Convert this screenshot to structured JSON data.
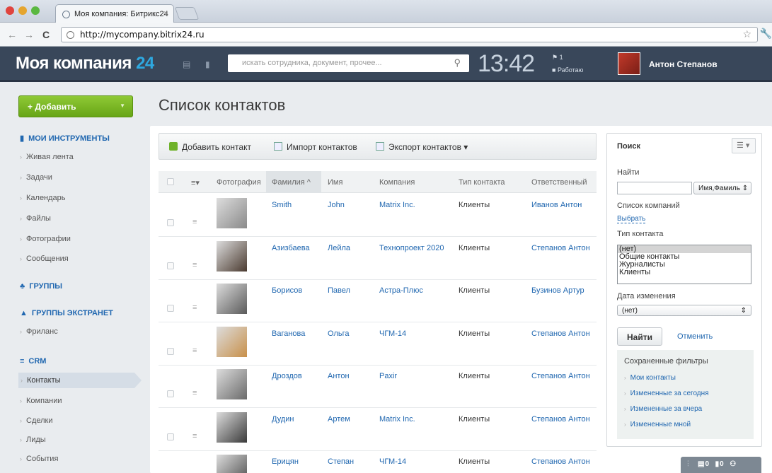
{
  "browser": {
    "tab_title": "Моя компания: Битрикс24",
    "tab_close": "×",
    "url": "http://mycompany.bitrix24.ru"
  },
  "header": {
    "logo_text": "Моя компания",
    "logo_number": "24",
    "search_placeholder": "искать сотрудника, документ, прочее...",
    "time": "13:42",
    "tasks_count": "1",
    "work_status": "Работаю",
    "user_name": "Антон Степанов"
  },
  "sidebar": {
    "add_button": "+ Добавить",
    "sections": {
      "tools": "МОИ ИНСТРУМЕНТЫ",
      "groups": "ГРУППЫ",
      "extranet": "ГРУППЫ ЭКСТРАНЕТ",
      "crm": "CRM"
    },
    "tools_items": [
      "Живая лента",
      "Задачи",
      "Календарь",
      "Файлы",
      "Фотографии",
      "Сообщения"
    ],
    "extranet_items": [
      "Фриланс"
    ],
    "crm_items": [
      "Контакты",
      "Компании",
      "Сделки",
      "Лиды",
      "События"
    ]
  },
  "page": {
    "title": "Список контактов"
  },
  "toolbar": {
    "add_contact": "Добавить контакт",
    "import": "Импорт контактов",
    "export": "Экспорт контактов"
  },
  "table": {
    "columns": {
      "photo": "Фотография",
      "last_name": "Фамилия",
      "first_name": "Имя",
      "company": "Компания",
      "type": "Тип контакта",
      "responsible": "Ответственный"
    },
    "sort_arrow": "^",
    "rows": [
      {
        "last_name": "Smith",
        "first_name": "John",
        "company": "Matrix Inc.",
        "type": "Клиенты",
        "responsible": "Иванов Антон",
        "photo_color": "#8a8a8a"
      },
      {
        "last_name": "Азизбаева",
        "first_name": "Лейла",
        "company": "Технопроект 2020",
        "type": "Клиенты",
        "responsible": "Степанов Антон",
        "photo_color": "#4a3a30"
      },
      {
        "last_name": "Борисов",
        "first_name": "Павел",
        "company": "Астра-Плюс",
        "type": "Клиенты",
        "responsible": "Бузинов Артур",
        "photo_color": "#5a5a5a"
      },
      {
        "last_name": "Ваганова",
        "first_name": "Ольга",
        "company": "ЧГМ-14",
        "type": "Клиенты",
        "responsible": "Степанов Антон",
        "photo_color": "#c8904a"
      },
      {
        "last_name": "Дроздов",
        "first_name": "Антон",
        "company": "Paxir",
        "type": "Клиенты",
        "responsible": "Степанов Антон",
        "photo_color": "#6a6a6a"
      },
      {
        "last_name": "Дудин",
        "first_name": "Артем",
        "company": "Matrix Inc.",
        "type": "Клиенты",
        "responsible": "Степанов Антон",
        "photo_color": "#3a3a3a"
      },
      {
        "last_name": "Ерицян",
        "first_name": "Степан",
        "company": "ЧГМ-14",
        "type": "Клиенты",
        "responsible": "Степанов Антон",
        "photo_color": "#4a4a4a"
      }
    ]
  },
  "filter": {
    "title": "Поиск",
    "find_label": "Найти",
    "find_mode": "Имя,Фамиль",
    "companies_label": "Список компаний",
    "choose_link": "Выбрать",
    "type_label": "Тип контакта",
    "type_options": [
      "(нет)",
      "Общие контакты",
      "Журналисты",
      "Клиенты"
    ],
    "date_label": "Дата изменения",
    "date_value": "(нет)",
    "find_button": "Найти",
    "cancel_link": "Отменить",
    "saved_title": "Сохраненные фильтры",
    "saved_items": [
      "Мои контакты",
      "Измененные за сегодня",
      "Измененные за вчера",
      "Измененные мной"
    ]
  },
  "bottombar": {
    "messages": "0",
    "notifications": "0"
  }
}
